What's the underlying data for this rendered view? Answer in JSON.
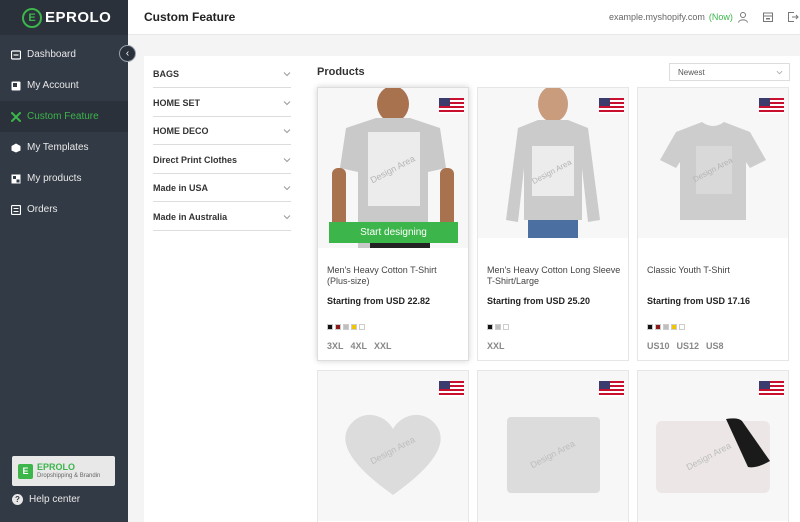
{
  "sidebar": {
    "logo_mark": "E",
    "logo_text": "EPROLO",
    "items": [
      {
        "label": "Dashboard",
        "icon": "dashboard-icon",
        "active": false
      },
      {
        "label": "My Account",
        "icon": "account-icon",
        "active": false
      },
      {
        "label": "Custom Feature",
        "icon": "tools-icon",
        "active": true
      },
      {
        "label": "My Templates",
        "icon": "templates-icon",
        "active": false
      },
      {
        "label": "My products",
        "icon": "products-icon",
        "active": false
      },
      {
        "label": "Orders",
        "icon": "orders-icon",
        "active": false
      }
    ],
    "brand_card": {
      "name": "EPROLO",
      "sub": "Dropshipping & Brandin"
    },
    "help_label": "Help center"
  },
  "header": {
    "title": "Custom Feature",
    "store": "example.myshopify.com",
    "status": "(Now)"
  },
  "filters": [
    "BAGS",
    "HOME SET",
    "HOME DECO",
    "Direct Print Clothes",
    "Made in USA",
    "Made in Australia"
  ],
  "products_section": {
    "title": "Products",
    "sort_selected": "Newest",
    "hover_button": "Start designing",
    "design_area_label": "Design Area"
  },
  "products": [
    {
      "name": "Men's Heavy Cotton T-Shirt (Plus-size)",
      "price": "Starting from USD 22.82",
      "swatches": [
        "#111111",
        "#8b1a1a",
        "#bfbfbf",
        "#f2c500",
        "#ffffff"
      ],
      "sizes": [
        "3XL",
        "4XL",
        "XXL"
      ]
    },
    {
      "name": "Men's Heavy Cotton Long Sleeve T-Shirt/Large",
      "price": "Starting from USD 25.20",
      "swatches": [
        "#111111",
        "#bfbfbf",
        "#ffffff"
      ],
      "sizes": [
        "XXL"
      ]
    },
    {
      "name": "Classic Youth T-Shirt",
      "price": "Starting from USD 17.16",
      "swatches": [
        "#111111",
        "#8b1a1a",
        "#bfbfbf",
        "#f2c500",
        "#ffffff"
      ],
      "sizes": [
        "US10",
        "US12",
        "US8"
      ]
    }
  ],
  "colors": {
    "brand": "#3cb54a",
    "sidebar": "#323a45"
  }
}
